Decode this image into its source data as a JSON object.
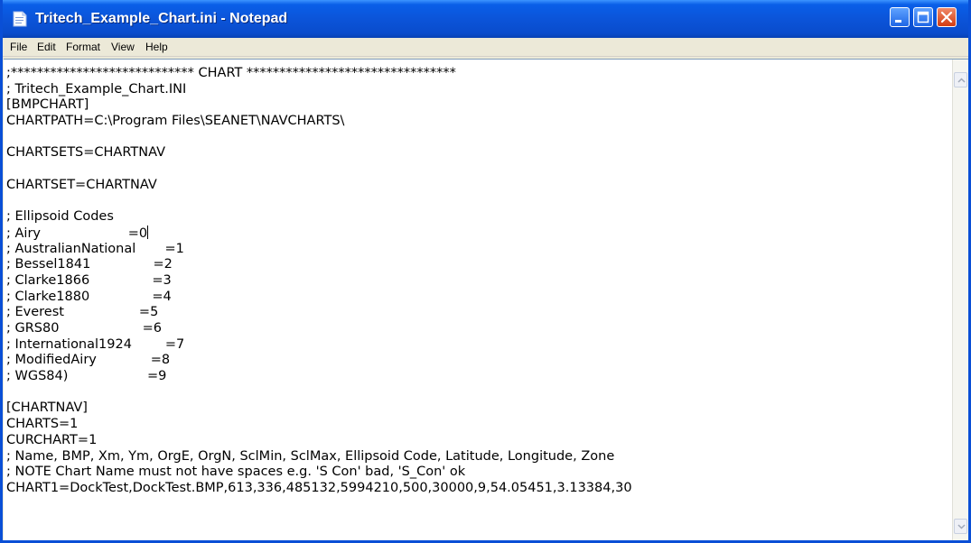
{
  "window": {
    "title": "Tritech_Example_Chart.ini - Notepad"
  },
  "menu": {
    "file": "File",
    "edit": "Edit",
    "format": "Format",
    "view": "View",
    "help": "Help"
  },
  "editor": {
    "lines": [
      ";**************************** CHART ********************************",
      "; Tritech_Example_Chart.INI",
      "[BMPCHART]",
      "CHARTPATH=C:\\Program Files\\SEANET\\NAVCHARTS\\",
      "",
      "CHARTSETS=CHARTNAV",
      "",
      "CHARTSET=CHARTNAV",
      "",
      "; Ellipsoid Codes",
      "; Airy                     =0",
      "; AustralianNational       =1",
      "; Bessel1841               =2",
      "; Clarke1866               =3",
      "; Clarke1880               =4",
      "; Everest                  =5",
      "; GRS80                    =6",
      "; International1924        =7",
      "; ModifiedAiry             =8",
      "; WGS84)                   =9",
      "",
      "[CHARTNAV]",
      "CHARTS=1",
      "CURCHART=1",
      "; Name, BMP, Xm, Ym, OrgE, OrgN, SclMin, SclMax, Ellipsoid Code, Latitude, Longitude, Zone",
      "; NOTE Chart Name must not have spaces e.g. 'S Con' bad, 'S_Con' ok",
      "CHART1=DockTest,DockTest.BMP,613,336,485132,5994210,500,30000,9,54.05451,3.13384,30"
    ]
  }
}
